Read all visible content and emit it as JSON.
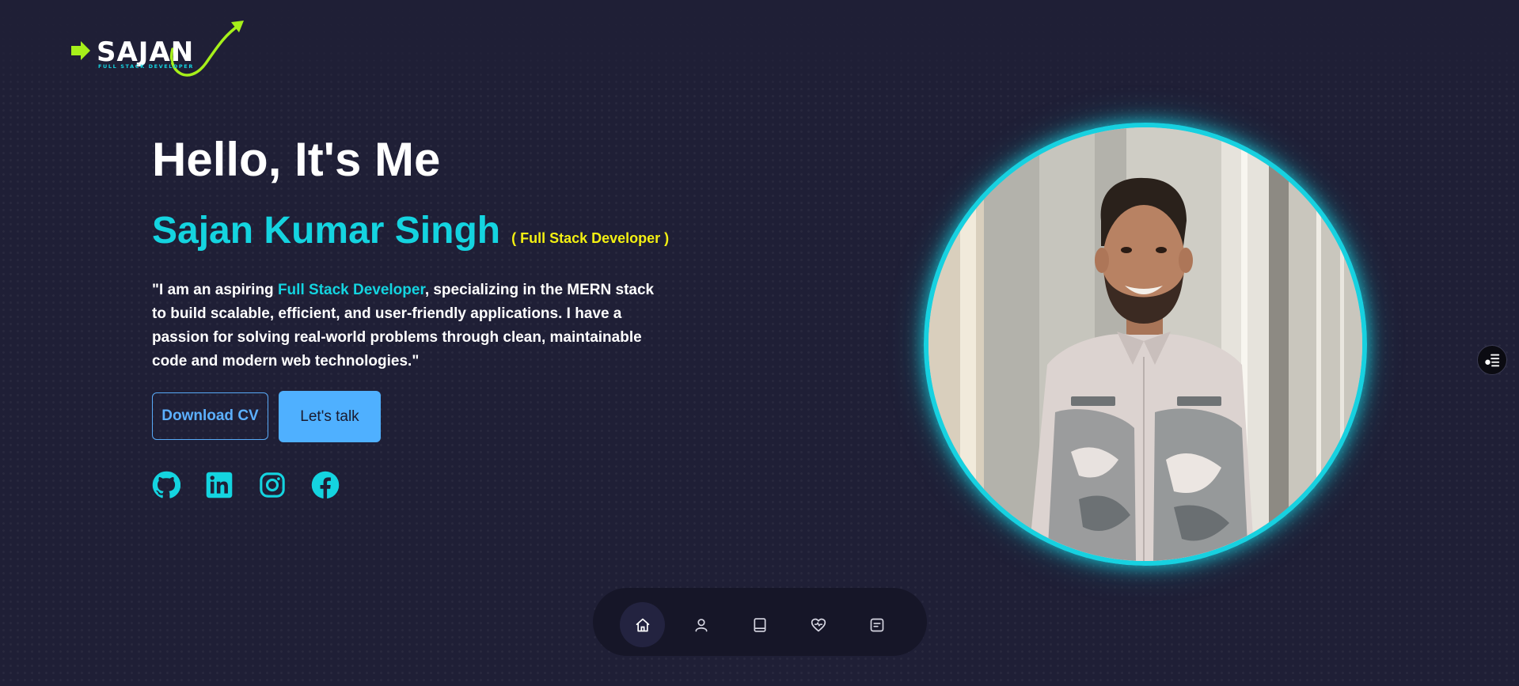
{
  "logo": {
    "wordmark": "SAJAN",
    "tagline": "FULL STACK DEVELOPER",
    "accent_color": "#a6f01a"
  },
  "hero": {
    "greeting": "Hello, It's Me",
    "name": "Sajan Kumar Singh",
    "role": "( Full Stack Developer )",
    "bio_before": "\"I am an aspiring ",
    "bio_highlight": "Full Stack Developer",
    "bio_after": ", specializing in the MERN stack to build scalable, efficient, and user-friendly applications. I have a passion for solving real-world problems through clean, maintainable code and modern web technologies.\""
  },
  "actions": {
    "download_cv": "Download CV",
    "lets_talk": "Let's talk"
  },
  "socials": [
    "github-icon",
    "linkedin-icon",
    "instagram-icon",
    "facebook-icon"
  ],
  "portrait": {
    "ring_color": "#17d1e0"
  },
  "side_widget": {
    "icon": "toggle-list-icon"
  },
  "bottom_nav": {
    "items": [
      {
        "icon": "home-icon",
        "active": true
      },
      {
        "icon": "user-icon",
        "active": false
      },
      {
        "icon": "book-icon",
        "active": false
      },
      {
        "icon": "heart-pulse-icon",
        "active": false
      },
      {
        "icon": "message-icon",
        "active": false
      }
    ]
  },
  "colors": {
    "background": "#1f1f36",
    "accent_cyan": "#14d4e0",
    "accent_yellow": "#f3f012",
    "button_blue": "#4fb0ff"
  }
}
